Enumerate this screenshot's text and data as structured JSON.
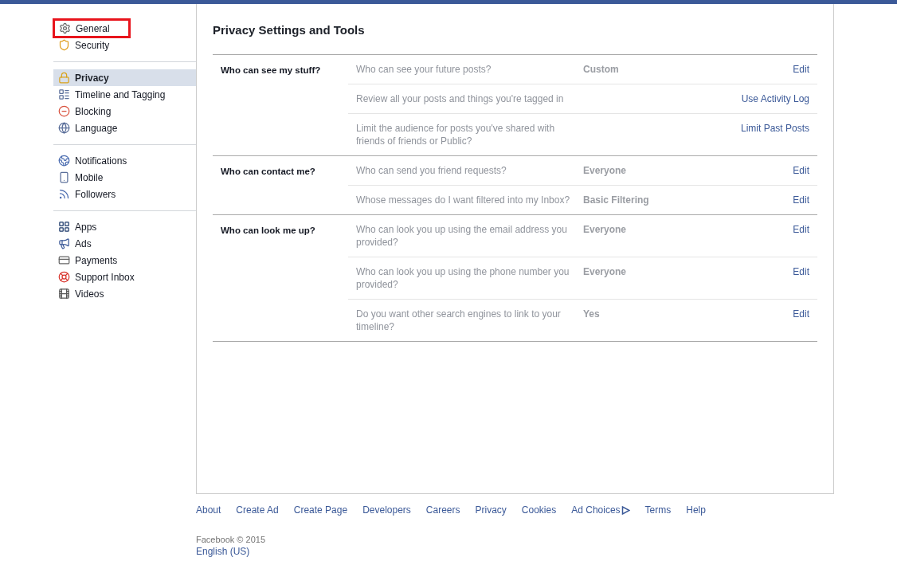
{
  "sidebar": {
    "groups": [
      {
        "items": [
          {
            "label": "General",
            "selected": false,
            "highlighted": true
          },
          {
            "label": "Security",
            "selected": false,
            "highlighted": false
          }
        ]
      },
      {
        "items": [
          {
            "label": "Privacy",
            "selected": true,
            "highlighted": false
          },
          {
            "label": "Timeline and Tagging",
            "selected": false,
            "highlighted": false
          },
          {
            "label": "Blocking",
            "selected": false,
            "highlighted": false
          },
          {
            "label": "Language",
            "selected": false,
            "highlighted": false
          }
        ]
      },
      {
        "items": [
          {
            "label": "Notifications",
            "selected": false,
            "highlighted": false
          },
          {
            "label": "Mobile",
            "selected": false,
            "highlighted": false
          },
          {
            "label": "Followers",
            "selected": false,
            "highlighted": false
          }
        ]
      },
      {
        "items": [
          {
            "label": "Apps",
            "selected": false,
            "highlighted": false
          },
          {
            "label": "Ads",
            "selected": false,
            "highlighted": false
          },
          {
            "label": "Payments",
            "selected": false,
            "highlighted": false
          },
          {
            "label": "Support Inbox",
            "selected": false,
            "highlighted": false
          },
          {
            "label": "Videos",
            "selected": false,
            "highlighted": false
          }
        ]
      }
    ]
  },
  "main": {
    "title": "Privacy Settings and Tools",
    "sections": [
      {
        "title": "Who can see my stuff?",
        "rows": [
          {
            "question": "Who can see your future posts?",
            "value": "Custom",
            "action": "Edit"
          },
          {
            "question": "Review all your posts and things you're tagged in",
            "action": "Use Activity Log"
          },
          {
            "question": "Limit the audience for posts you've shared with friends of friends or Public?",
            "action": "Limit Past Posts"
          }
        ]
      },
      {
        "title": "Who can contact me?",
        "rows": [
          {
            "question": "Who can send you friend requests?",
            "value": "Everyone",
            "action": "Edit"
          },
          {
            "question": "Whose messages do I want filtered into my Inbox?",
            "value": "Basic Filtering",
            "action": "Edit"
          }
        ]
      },
      {
        "title": "Who can look me up?",
        "rows": [
          {
            "question": "Who can look you up using the email address you provided?",
            "value": "Everyone",
            "action": "Edit"
          },
          {
            "question": "Who can look you up using the phone number you provided?",
            "value": "Everyone",
            "action": "Edit"
          },
          {
            "question": "Do you want other search engines to link to your timeline?",
            "value": "Yes",
            "action": "Edit"
          }
        ]
      }
    ]
  },
  "footer": {
    "links": [
      "About",
      "Create Ad",
      "Create Page",
      "Developers",
      "Careers",
      "Privacy",
      "Cookies",
      "Ad Choices",
      "Terms",
      "Help"
    ],
    "copyright": "Facebook © 2015",
    "language": "English (US)"
  }
}
